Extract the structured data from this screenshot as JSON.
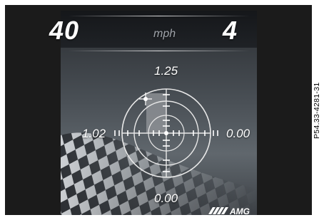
{
  "speed": {
    "value": "40",
    "unit": "mph"
  },
  "gear": "4",
  "g_meter": {
    "top": "1.25",
    "left": "1.02",
    "right": "0.00",
    "bottom": "0.00"
  },
  "brand": "AMG",
  "figure_code": "P54.33-4281-31",
  "colors": {
    "panel": "#1b1b1b",
    "text": "#ffffff",
    "unit": "#9fa4aa",
    "brake_fill": "#9a9da1"
  },
  "icons": {
    "logo": "amg-logo",
    "background": "checkered-flag"
  }
}
